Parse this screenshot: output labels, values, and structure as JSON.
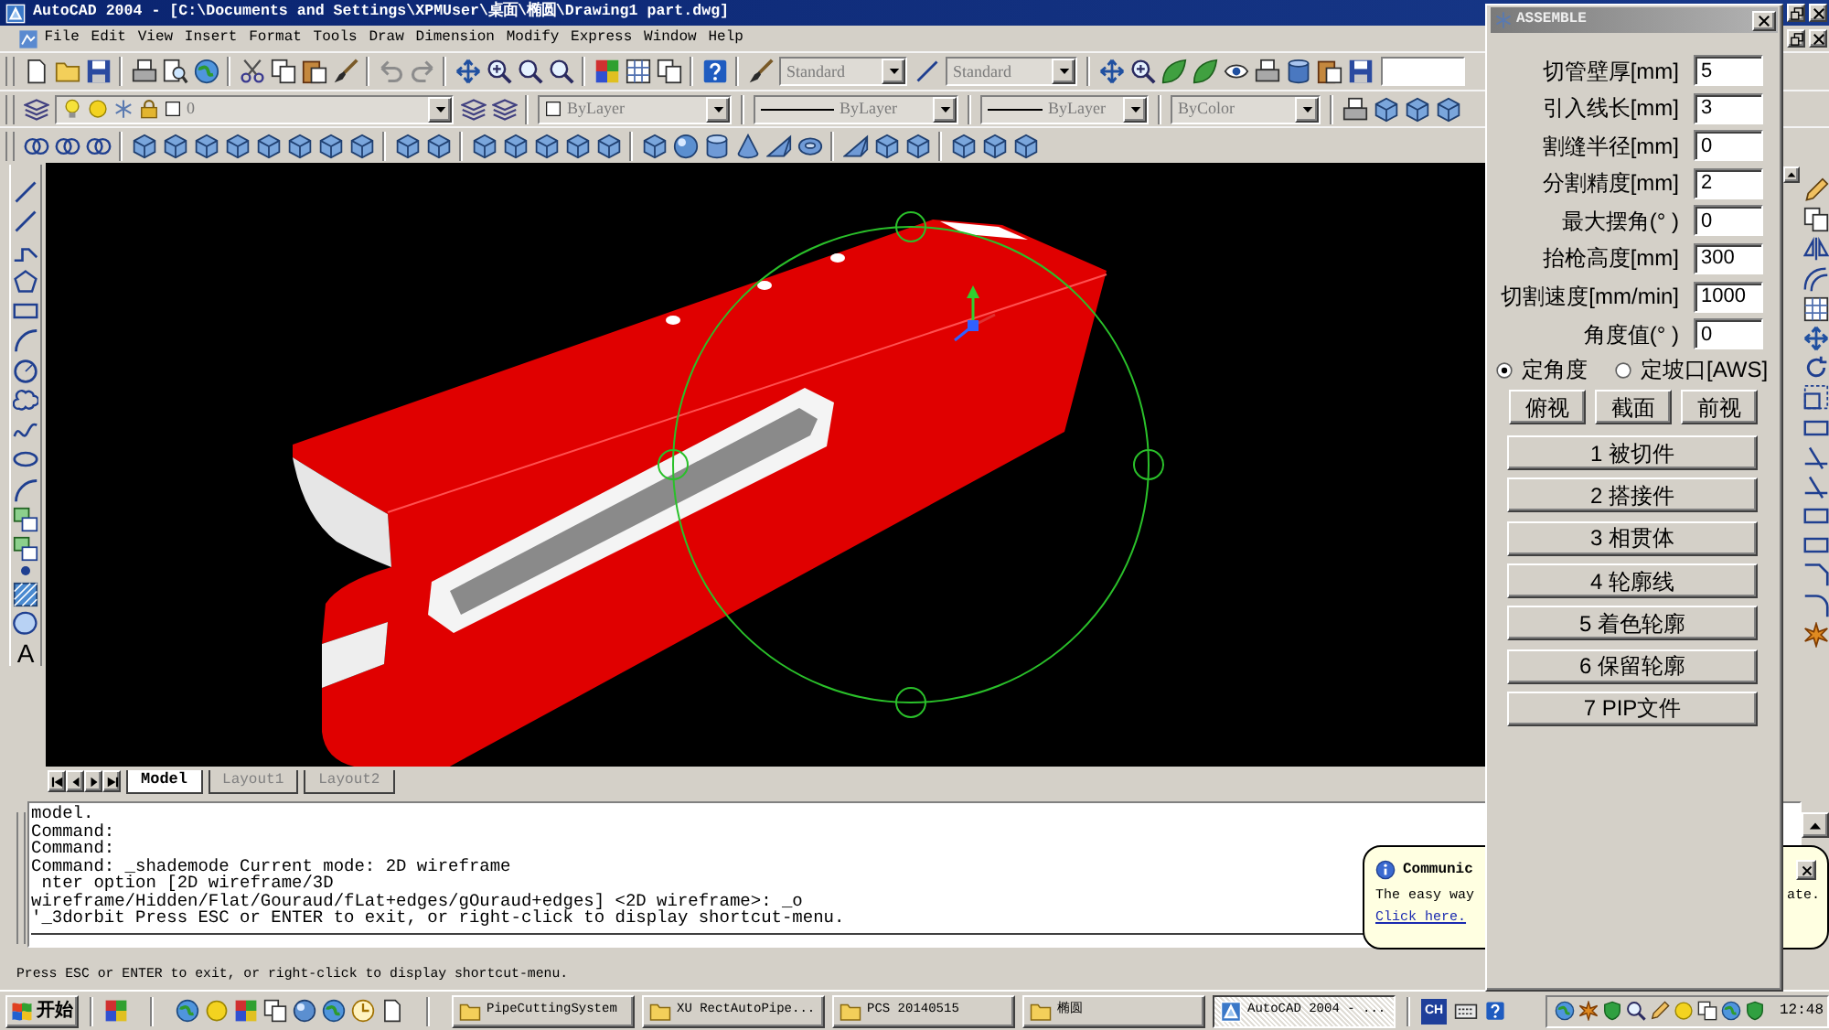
{
  "window": {
    "title": "AutoCAD 2004 - [C:\\Documents and Settings\\XPMUser\\桌面\\椭圆\\Drawing1 part.dwg]"
  },
  "menu": [
    "File",
    "Edit",
    "View",
    "Insert",
    "Format",
    "Tools",
    "Draw",
    "Dimension",
    "Modify",
    "Express",
    "Window",
    "Help"
  ],
  "toolbars": {
    "text_style": "Standard",
    "dim_style": "Standard",
    "layer": "0",
    "color_control": "ByLayer",
    "linetype": "ByLayer",
    "lineweight": "ByLayer",
    "plot_style": "ByColor"
  },
  "draw_toolbar": {
    "text_tool": "A"
  },
  "layout_tabs": [
    {
      "label": "Model",
      "selected": true
    },
    {
      "label": "Layout1",
      "selected": false
    },
    {
      "label": "Layout2",
      "selected": false
    }
  ],
  "command_history": [
    "model.",
    "Command:",
    "Command:",
    "Command: _shademode Current mode: 2D wireframe",
    " nter option [2D wireframe/3D",
    "wireframe/Hidden/Flat/Gouraud/fLat+edges/gOuraud+edges] <2D wireframe>: _o",
    "'_3dorbit Press ESC or ENTER to exit, or right-click to display shortcut-menu."
  ],
  "status_line": "Press ESC or ENTER to exit, or right-click to display shortcut-menu.",
  "assemble_panel": {
    "title": "ASSEMBLE",
    "fields": [
      {
        "label": "切管壁厚[mm]",
        "value": "5"
      },
      {
        "label": "引入线长[mm]",
        "value": "3"
      },
      {
        "label": "割缝半径[mm]",
        "value": "0"
      },
      {
        "label": "分割精度[mm]",
        "value": "2"
      },
      {
        "label": "最大摆角(° )",
        "value": "0"
      },
      {
        "label": "抬枪高度[mm]",
        "value": "300"
      },
      {
        "label": "切割速度[mm/min]",
        "value": "1000"
      },
      {
        "label": "角度值(° )",
        "value": "0"
      }
    ],
    "angle_modes": [
      {
        "label": "定角度",
        "selected": true
      },
      {
        "label": "定坡口[AWS]",
        "selected": false
      }
    ],
    "view_buttons": [
      "俯视",
      "截面",
      "前视"
    ],
    "step_buttons": [
      "1 被切件",
      "2 搭接件",
      "3 相贯体",
      "4 轮廓线",
      "5 着色轮廓",
      "6 保留轮廓",
      "7 PIP文件"
    ]
  },
  "notification": {
    "title": "Communic",
    "text_left": "The easy way",
    "text_right": "ate.",
    "link": "Click here."
  },
  "taskbar": {
    "start": "开始",
    "tasks": [
      {
        "label": "PipeCuttingSystem",
        "kind": "folder",
        "selected": false
      },
      {
        "label": "XU RectAutoPipe...",
        "kind": "folder",
        "selected": false
      },
      {
        "label": "PCS 20140515",
        "kind": "folder",
        "selected": false
      },
      {
        "label": "椭圆",
        "kind": "folder",
        "selected": false
      },
      {
        "label": "AutoCAD 2004 - ...",
        "kind": "app",
        "selected": true
      }
    ],
    "language": "CH",
    "clock": "12:48"
  }
}
